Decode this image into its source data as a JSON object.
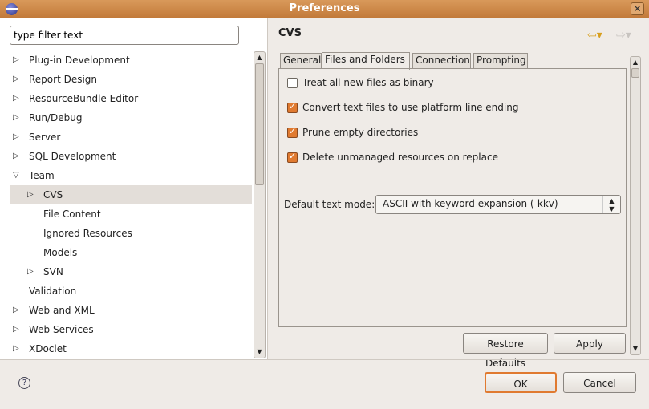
{
  "window": {
    "title": "Preferences",
    "close": "✕"
  },
  "filter": {
    "placeholder": "type filter text",
    "value": "type filter text"
  },
  "tree": [
    {
      "label": "Plug-in Development",
      "level": 0,
      "arrow": "▷"
    },
    {
      "label": "Report Design",
      "level": 0,
      "arrow": "▷"
    },
    {
      "label": "ResourceBundle Editor",
      "level": 0,
      "arrow": "▷"
    },
    {
      "label": "Run/Debug",
      "level": 0,
      "arrow": "▷"
    },
    {
      "label": "Server",
      "level": 0,
      "arrow": "▷"
    },
    {
      "label": "SQL Development",
      "level": 0,
      "arrow": "▷"
    },
    {
      "label": "Team",
      "level": 0,
      "arrow": "▽"
    },
    {
      "label": "CVS",
      "level": 1,
      "arrow": "▷",
      "selected": true
    },
    {
      "label": "File Content",
      "level": 1,
      "arrow": ""
    },
    {
      "label": "Ignored Resources",
      "level": 1,
      "arrow": ""
    },
    {
      "label": "Models",
      "level": 1,
      "arrow": ""
    },
    {
      "label": "SVN",
      "level": 1,
      "arrow": "▷"
    },
    {
      "label": "Validation",
      "level": 0,
      "arrow": ""
    },
    {
      "label": "Web and XML",
      "level": 0,
      "arrow": "▷"
    },
    {
      "label": "Web Services",
      "level": 0,
      "arrow": "▷"
    },
    {
      "label": "XDoclet",
      "level": 0,
      "arrow": "▷"
    }
  ],
  "page": {
    "title": "CVS",
    "back": "⇦▾",
    "forward": "⇨▾"
  },
  "tabs": [
    "General",
    "Files and Folders",
    "Connection",
    "Prompting"
  ],
  "options": [
    {
      "label": "Treat all new files as binary",
      "checked": false
    },
    {
      "label": "Convert text files to use platform line ending",
      "checked": true
    },
    {
      "label": "Prune empty directories",
      "checked": true
    },
    {
      "label": "Delete unmanaged resources on replace",
      "checked": true
    }
  ],
  "text_mode": {
    "label": "Default text mode:",
    "value": "ASCII with keyword expansion (-kkv)"
  },
  "buttons": {
    "restore": "Restore Defaults",
    "apply": "Apply",
    "ok": "OK",
    "cancel": "Cancel",
    "help": "?"
  },
  "colors": {
    "titlebar": "#c98540",
    "check": "#e07a30"
  }
}
